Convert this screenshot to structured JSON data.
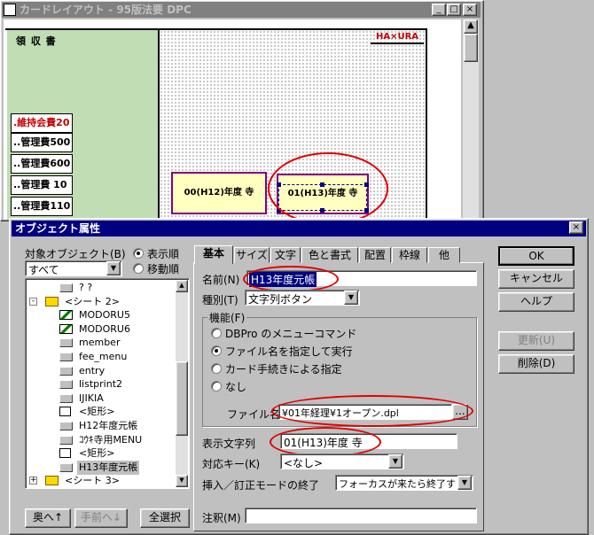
{
  "layout_window": {
    "title": "カードレイアウト - 95版法要 DPC",
    "heading": "領 収 書",
    "logo": "HA×URA",
    "side_buttons": [
      ".維持会費20",
      "..管理費500",
      "..管理費600",
      "..管理費 10",
      "..管理費110"
    ],
    "card1_label": "00(H12)年度 寺",
    "card2_label": "01(H13)年度 寺"
  },
  "dialog": {
    "title": "オブジェクト属性",
    "target_label": "対象オブジェクト(B)",
    "target_value": "すべて",
    "order_display": "表示順",
    "order_move": "移動順",
    "tree": [
      {
        "label": "? ?",
        "level": 2,
        "icon": "rect"
      },
      {
        "label": "<シート 2>",
        "level": 1,
        "icon": "folder",
        "expander": "-"
      },
      {
        "label": "MODORU5",
        "level": 2,
        "icon": "image"
      },
      {
        "label": "MODORU6",
        "level": 2,
        "icon": "image"
      },
      {
        "label": "member",
        "level": 2,
        "icon": "rect"
      },
      {
        "label": "fee_menu",
        "level": 2,
        "icon": "rect"
      },
      {
        "label": "entry",
        "level": 2,
        "icon": "rect"
      },
      {
        "label": "listprint2",
        "level": 2,
        "icon": "rect"
      },
      {
        "label": "IJIKIA",
        "level": 2,
        "icon": "rect"
      },
      {
        "label": "<矩形>",
        "level": 2,
        "icon": "box"
      },
      {
        "label": "H12年度元帳",
        "level": 2,
        "icon": "rect"
      },
      {
        "label": "ｺｳｷ寺用MENU",
        "level": 2,
        "icon": "rect"
      },
      {
        "label": "<矩形>",
        "level": 2,
        "icon": "box"
      },
      {
        "label": "H13年度元帳",
        "level": 2,
        "icon": "rect",
        "selected": true
      },
      {
        "label": "<シート 3>",
        "level": 1,
        "icon": "folder",
        "expander": "+"
      }
    ],
    "btn_back": "奥へ↑",
    "btn_front": "手前へ↓",
    "btn_select_all": "全選択",
    "tabs": [
      "基本",
      "サイズ",
      "文字",
      "色と書式",
      "配置",
      "枠線",
      "他"
    ],
    "name_label": "名前(N)",
    "name_value": "H13年度元帳",
    "kind_label": "種別(T)",
    "kind_value": "文字列ボタン",
    "func_group": "機能(F)",
    "func_options": [
      "DBPro のメニューコマンド",
      "ファイル名を指定して実行",
      "カード手続きによる指定",
      "なし"
    ],
    "func_selected": 1,
    "file_label": "ファイル名",
    "file_value": "¥01年経理¥1オープン.dpl",
    "file_browse": "...",
    "display_label": "表示文字列",
    "display_value": "01(H13)年度 寺",
    "key_label": "対応キー(K)",
    "key_value": "<なし>",
    "insert_label": "挿入／訂正モードの終了",
    "insert_value": "フォーカスが来たら終了す",
    "note_label": "注釈(M)",
    "note_value": "",
    "btn_ok": "OK",
    "btn_cancel": "キャンセル",
    "btn_help": "ヘルプ",
    "btn_update": "更新(U)",
    "btn_delete": "削除(D)"
  },
  "colors": {
    "titlebar": "#000080",
    "side_panel": "#c0ddb4",
    "card_fill": "#ffffc0",
    "card_border": "#800080",
    "annotation": "#e00000"
  }
}
